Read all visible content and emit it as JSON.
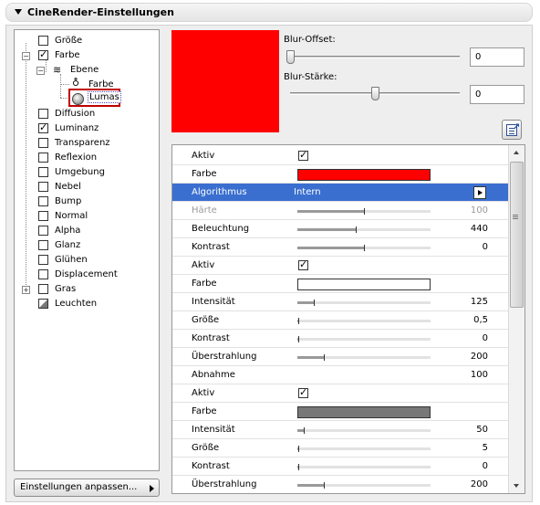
{
  "header": {
    "title": "CineRender-Einstellungen"
  },
  "tree": {
    "items": [
      {
        "label": "Größe",
        "checked": false
      },
      {
        "label": "Farbe",
        "checked": true
      },
      {
        "label": "Ebene"
      },
      {
        "label": "Farbe"
      },
      {
        "label": "Lumas"
      },
      {
        "label": "Diffusion",
        "checked": false
      },
      {
        "label": "Luminanz",
        "checked": true
      },
      {
        "label": "Transparenz",
        "checked": false
      },
      {
        "label": "Reflexion",
        "checked": false
      },
      {
        "label": "Umgebung",
        "checked": false
      },
      {
        "label": "Nebel",
        "checked": false
      },
      {
        "label": "Bump",
        "checked": false
      },
      {
        "label": "Normal",
        "checked": false
      },
      {
        "label": "Alpha",
        "checked": false
      },
      {
        "label": "Glanz",
        "checked": false
      },
      {
        "label": "Glühen",
        "checked": false
      },
      {
        "label": "Displacement",
        "checked": false
      },
      {
        "label": "Gras",
        "checked": false
      },
      {
        "label": "Leuchten"
      }
    ]
  },
  "footer": {
    "adjust_button": "Einstellungen anpassen..."
  },
  "preview": {
    "color": "#ff0000"
  },
  "blur": {
    "offset_label": "Blur-Offset:",
    "offset_value": "0",
    "offset_level": 0,
    "strength_label": "Blur-Stärke:",
    "strength_value": "0",
    "strength_level": 0.5
  },
  "properties": [
    {
      "name": "Aktiv",
      "type": "check"
    },
    {
      "name": "Farbe",
      "type": "color",
      "color": "#ff0000"
    },
    {
      "name": "Algorithmus",
      "type": "select",
      "value": "Intern",
      "selected": true
    },
    {
      "name": "Härte",
      "type": "slider",
      "value": "100",
      "level": 0.5,
      "dim": true
    },
    {
      "name": "Beleuchtung",
      "type": "slider",
      "value": "440",
      "level": 0.44
    },
    {
      "name": "Kontrast",
      "type": "slider",
      "value": "0",
      "level": 0.5
    },
    {
      "name": "Aktiv",
      "type": "check"
    },
    {
      "name": "Farbe",
      "type": "color",
      "color": "#ffffff"
    },
    {
      "name": "Intensität",
      "type": "slider",
      "value": "125",
      "level": 0.12
    },
    {
      "name": "Größe",
      "type": "slider",
      "value": "0,5",
      "level": 0.0
    },
    {
      "name": "Kontrast",
      "type": "slider",
      "value": "0",
      "level": 0.0
    },
    {
      "name": "Überstrahlung",
      "type": "slider",
      "value": "200",
      "level": 0.2
    },
    {
      "name": "Abnahme",
      "type": "text",
      "value": "100"
    },
    {
      "name": "Aktiv",
      "type": "check"
    },
    {
      "name": "Farbe",
      "type": "color",
      "color": "#777777"
    },
    {
      "name": "Intensität",
      "type": "slider",
      "value": "50",
      "level": 0.05
    },
    {
      "name": "Größe",
      "type": "slider",
      "value": "5",
      "level": 0.0
    },
    {
      "name": "Kontrast",
      "type": "slider",
      "value": "0",
      "level": 0.0
    },
    {
      "name": "Überstrahlung",
      "type": "slider",
      "value": "200",
      "level": 0.2
    }
  ]
}
